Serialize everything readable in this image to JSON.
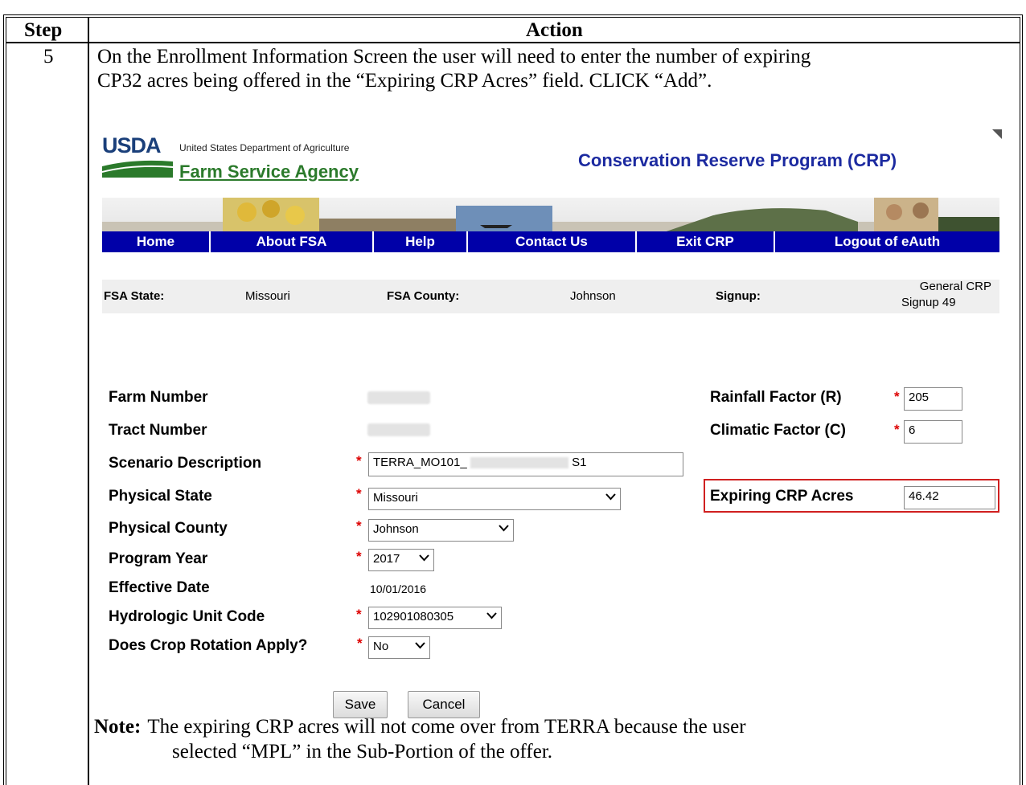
{
  "table": {
    "header_step": "Step",
    "header_action": "Action",
    "step_number": "5",
    "paragraph_line1": "On the Enrollment Information Screen the user will need to enter the number of expiring",
    "paragraph_line2": "CP32 acres being offered in the “Expiring CRP Acres” field.  CLICK “Add”.",
    "note_label": "Note:",
    "note_line1": "The expiring CRP acres will not come over from TERRA because the user",
    "note_line2": "selected “MPL” in the Sub-Portion of the offer."
  },
  "header": {
    "usda_logo_text": "USDA",
    "department": "United States Department of Agriculture",
    "agency_link": "Farm Service Agency",
    "program_title": "Conservation Reserve Program (CRP)"
  },
  "nav": [
    "Home",
    "About FSA",
    "Help",
    "Contact Us",
    "Exit CRP",
    "Logout of eAuth"
  ],
  "info": {
    "state_label": "FSA State:",
    "state_value": "Missouri",
    "county_label": "FSA County:",
    "county_value": "Johnson",
    "signup_label": "Signup:",
    "signup_value_line1": "General CRP",
    "signup_value_line2": "Signup 49"
  },
  "form": {
    "farm_number_label": "Farm Number",
    "tract_number_label": "Tract Number",
    "scenario_label": "Scenario Description",
    "scenario_value_prefix": "TERRA_MO101_",
    "scenario_value_suffix": "S1",
    "physical_state_label": "Physical State",
    "physical_state_value": "Missouri",
    "physical_county_label": "Physical County",
    "physical_county_value": "Johnson",
    "program_year_label": "Program Year",
    "program_year_value": "2017",
    "effective_date_label": "Effective Date",
    "effective_date_value": "10/01/2016",
    "huc_label": "Hydrologic Unit Code",
    "huc_value": "102901080305",
    "crop_rotation_label": "Does Crop Rotation Apply?",
    "crop_rotation_value": "No",
    "rainfall_label": "Rainfall Factor (R)",
    "rainfall_value": "205",
    "climatic_label": "Climatic Factor (C)",
    "climatic_value": "6",
    "expiring_label": "Expiring CRP Acres",
    "expiring_value": "46.42",
    "required_mark": "*",
    "save_label": "Save",
    "cancel_label": "Cancel"
  },
  "colors": {
    "nav_bg": "#0000a8",
    "agency_green": "#2b7a2b",
    "title_blue": "#1c2aa0",
    "highlight_red": "#d02020",
    "required_red": "#dd0000"
  }
}
